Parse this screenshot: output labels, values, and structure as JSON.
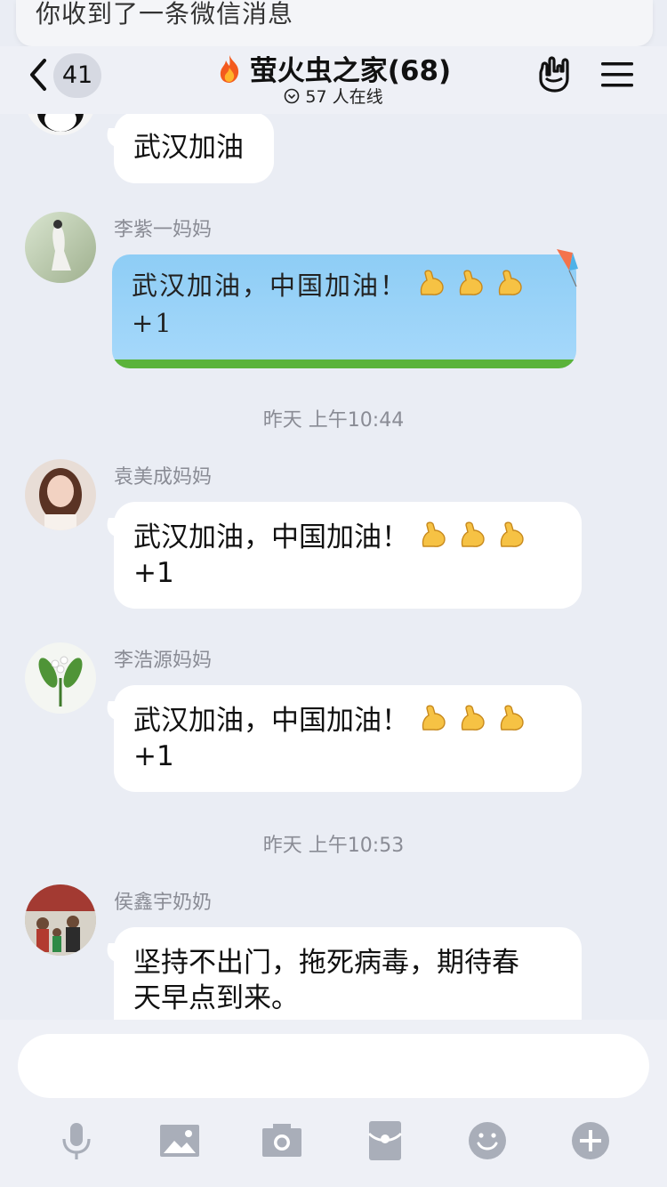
{
  "notification": {
    "text": "你收到了一条微信消息"
  },
  "header": {
    "back_count": "41",
    "title": "萤火虫之家(68)",
    "online": "57 人在线"
  },
  "messages": [
    {
      "text": "武汉加油"
    },
    {
      "sender": "李紫一妈妈",
      "text_line1": "武汉加油，中国加油！",
      "text_line2": "+1"
    },
    {
      "timestamp": "昨天 上午10:44"
    },
    {
      "sender": "袁美成妈妈",
      "text_line1": "武汉加油，中国加油！",
      "text_line2": "+1"
    },
    {
      "sender": "李浩源妈妈",
      "text_line1": "武汉加油，中国加油！",
      "text_line2": "+1"
    },
    {
      "timestamp": "昨天 上午10:53"
    },
    {
      "sender": "侯鑫宇奶奶",
      "text_line1": "坚持不出门，拖死病毒，期待春",
      "text_line2": "天早点到来。"
    }
  ],
  "input": {
    "placeholder": ""
  },
  "toolbar": [
    "microphone-icon",
    "image-icon",
    "camera-icon",
    "red-packet-icon",
    "emoji-icon",
    "plus-icon"
  ],
  "colors": {
    "background": "#eaedf4",
    "bubble": "#ffffff",
    "icon": "#a9aeb9",
    "sender": "#8a8c95"
  }
}
